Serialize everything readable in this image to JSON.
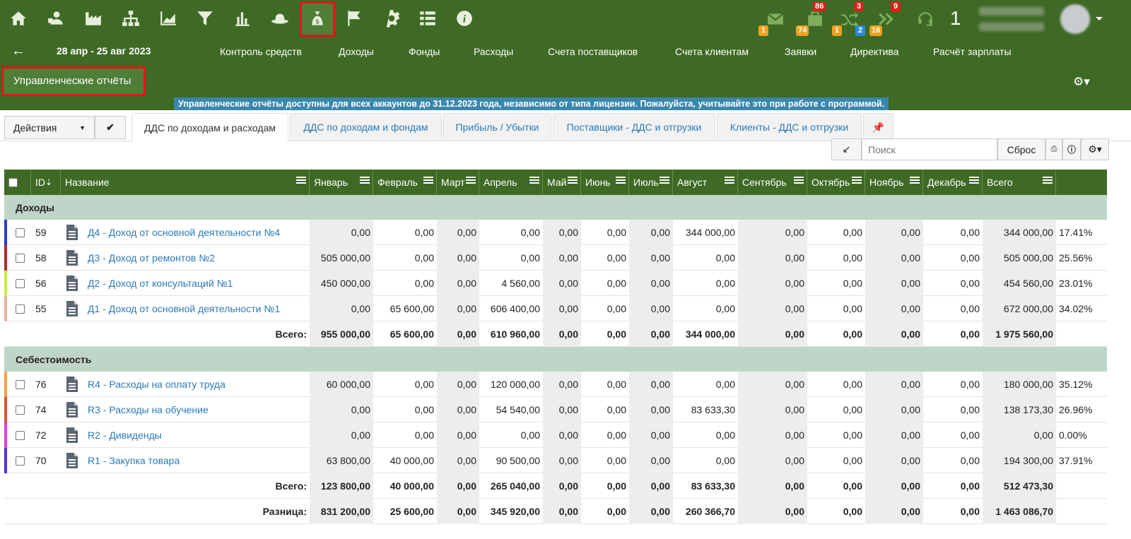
{
  "topbar": {
    "icons": [
      "home-icon",
      "contacts-icon",
      "factory-icon",
      "structure-icon",
      "chart-area-icon",
      "filter-icon",
      "bar-chart-icon",
      "hat-icon",
      "money-bag-icon",
      "flag-icon",
      "gear-icon",
      "list-icon",
      "info-icon"
    ],
    "notifications": [
      {
        "icon": "mail-icon",
        "top_badge": "",
        "bottom_badge": "1"
      },
      {
        "icon": "briefcase-icon",
        "top_badge": "86",
        "bottom_badge": "74"
      },
      {
        "icon": "shuffle-icon",
        "top_badge": "3",
        "bottom_badge": "1",
        "bottom_badge2": "2"
      },
      {
        "icon": "double-chevron-icon",
        "top_badge": "9",
        "bottom_badge": "16"
      },
      {
        "icon": "headset-icon",
        "top_badge": "",
        "bottom_badge": ""
      }
    ],
    "counter": "1"
  },
  "nav": {
    "date_range": "28 апр - 25 авг 2023",
    "menu": [
      "Контроль средств",
      "Доходы",
      "Фонды",
      "Расходы",
      "Счета поставщиков",
      "Счета клиентам",
      "Заявки",
      "Директива",
      "Расчёт зарплаты"
    ],
    "section_button": "Управленческие отчёты",
    "notice": "Управленческие отчёты доступны для всех аккаунтов до 31.12.2023 года, независимо от типа лицензии. Пожалуйста, учитывайте это при работе с программой."
  },
  "toolbar": {
    "actions_label": "Действия",
    "tabs": [
      "ДДС по доходам и расходам",
      "ДДС по доходам и фондам",
      "Прибыль / Убытки",
      "Поставщики - ДДС и отгрузки",
      "Клиенты - ДДС и отгрузки"
    ],
    "search_placeholder": "Поиск",
    "reset_label": "Сброс"
  },
  "table": {
    "headers": [
      "ID",
      "Название",
      "Январь",
      "Февраль",
      "Март",
      "Апрель",
      "Май",
      "Июнь",
      "Июль",
      "Август",
      "Сентябрь",
      "Октябрь",
      "Ноябрь",
      "Декабрь",
      "Всего"
    ],
    "income_section": "Доходы",
    "income_rows": [
      {
        "id": "59",
        "name": "Д4 - Доход от основной деятельности №4",
        "color": "#2a3ad0",
        "values": [
          "0,00",
          "0,00",
          "0,00",
          "0,00",
          "0,00",
          "0,00",
          "0,00",
          "344 000,00",
          "0,00",
          "0,00",
          "0,00",
          "0,00",
          "344 000,00"
        ],
        "pct": "17.41%"
      },
      {
        "id": "58",
        "name": "Д3 - Доход от ремонтов №2",
        "color": "#b02a2a",
        "values": [
          "505 000,00",
          "0,00",
          "0,00",
          "0,00",
          "0,00",
          "0,00",
          "0,00",
          "0,00",
          "0,00",
          "0,00",
          "0,00",
          "0,00",
          "505 000,00"
        ],
        "pct": "25.56%"
      },
      {
        "id": "56",
        "name": "Д2 - Доход от консультаций №1",
        "color": "#c8ef40",
        "values": [
          "450 000,00",
          "0,00",
          "0,00",
          "4 560,00",
          "0,00",
          "0,00",
          "0,00",
          "0,00",
          "0,00",
          "0,00",
          "0,00",
          "0,00",
          "454 560,00"
        ],
        "pct": "23.01%"
      },
      {
        "id": "55",
        "name": "Д1 - Доход от основной деятельности №1",
        "color": "#e8b0a0",
        "values": [
          "0,00",
          "65 600,00",
          "0,00",
          "606 400,00",
          "0,00",
          "0,00",
          "0,00",
          "0,00",
          "0,00",
          "0,00",
          "0,00",
          "0,00",
          "672 000,00"
        ],
        "pct": "34.02%"
      }
    ],
    "income_total_label": "Всего:",
    "income_total": [
      "955 000,00",
      "65 600,00",
      "0,00",
      "610 960,00",
      "0,00",
      "0,00",
      "0,00",
      "344 000,00",
      "0,00",
      "0,00",
      "0,00",
      "0,00",
      "1 975 560,00"
    ],
    "cost_section": "Себестоимость",
    "cost_rows": [
      {
        "id": "76",
        "name": "R4 - Расходы на оплату труда",
        "color": "#f0a050",
        "values": [
          "60 000,00",
          "0,00",
          "0,00",
          "120 000,00",
          "0,00",
          "0,00",
          "0,00",
          "0,00",
          "0,00",
          "0,00",
          "0,00",
          "0,00",
          "180 000,00"
        ],
        "pct": "35.12%"
      },
      {
        "id": "74",
        "name": "R3 - Расходы на обучение",
        "color": "#e05030",
        "values": [
          "0,00",
          "0,00",
          "0,00",
          "54 540,00",
          "0,00",
          "0,00",
          "0,00",
          "83 633,30",
          "0,00",
          "0,00",
          "0,00",
          "0,00",
          "138 173,30"
        ],
        "pct": "26.96%"
      },
      {
        "id": "72",
        "name": "R2 - Дивиденды",
        "color": "#e040e0",
        "values": [
          "0,00",
          "0,00",
          "0,00",
          "0,00",
          "0,00",
          "0,00",
          "0,00",
          "0,00",
          "0,00",
          "0,00",
          "0,00",
          "0,00",
          "0,00"
        ],
        "pct": "0.00%"
      },
      {
        "id": "70",
        "name": "R1 - Закупка товара",
        "color": "#5030e0",
        "values": [
          "63 800,00",
          "40 000,00",
          "0,00",
          "90 500,00",
          "0,00",
          "0,00",
          "0,00",
          "0,00",
          "0,00",
          "0,00",
          "0,00",
          "0,00",
          "194 300,00"
        ],
        "pct": "37.91%"
      }
    ],
    "cost_total_label": "Всего:",
    "cost_total": [
      "123 800,00",
      "40 000,00",
      "0,00",
      "265 040,00",
      "0,00",
      "0,00",
      "0,00",
      "83 633,30",
      "0,00",
      "0,00",
      "0,00",
      "0,00",
      "512 473,30"
    ],
    "diff_label": "Разница:",
    "diff_total": [
      "831 200,00",
      "25 600,00",
      "0,00",
      "345 920,00",
      "0,00",
      "0,00",
      "0,00",
      "260 366,70",
      "0,00",
      "0,00",
      "0,00",
      "0,00",
      "1 463 086,70"
    ]
  }
}
